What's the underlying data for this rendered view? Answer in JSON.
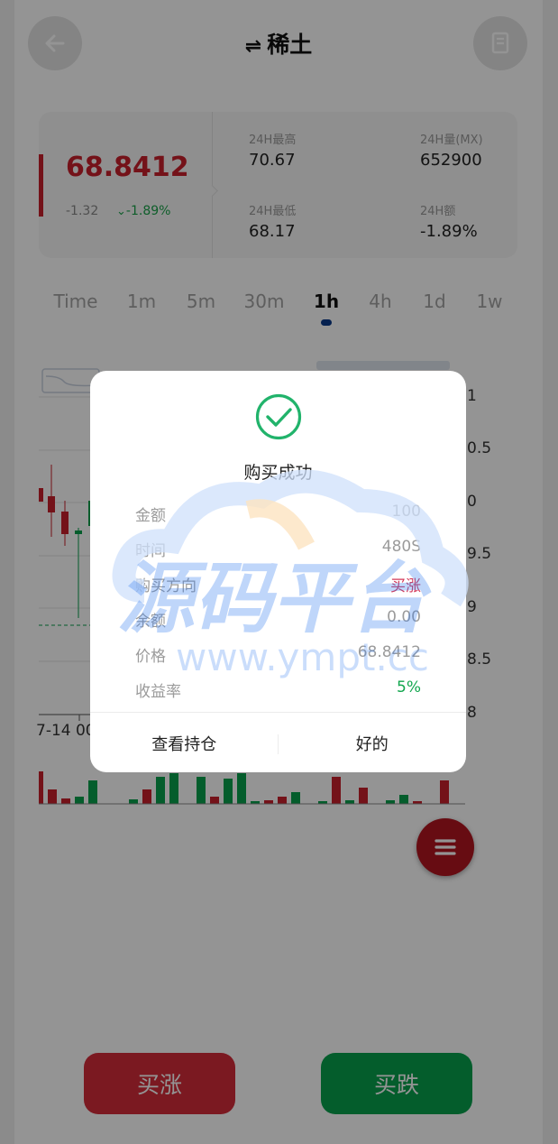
{
  "header": {
    "title": "稀土",
    "swap_symbol": "⇌",
    "back_icon": "arrow-left-icon",
    "book_icon": "document-icon"
  },
  "stats": {
    "price": "68.8412",
    "change": "-1.32",
    "change_pct": "-1.89%",
    "items": [
      {
        "label": "24H最高",
        "value": "70.67"
      },
      {
        "label": "24H量(MX)",
        "value": "652900"
      },
      {
        "label": "24H最低",
        "value": "68.17"
      },
      {
        "label": "24H额",
        "value": "-1.89%"
      }
    ]
  },
  "tabs": [
    "Time",
    "1m",
    "5m",
    "30m",
    "1h",
    "4h",
    "1d",
    "1w"
  ],
  "active_tab": "1h",
  "chart": {
    "y_labels": [
      "1",
      "0.5",
      "0",
      "9.5",
      "9",
      "8.5",
      "8"
    ],
    "x_labels": [
      "7-14 00"
    ]
  },
  "buttons": {
    "buy": "买涨",
    "sell": "买跌"
  },
  "modal": {
    "title": "购买成功",
    "rows": [
      {
        "label": "金额",
        "value": "100"
      },
      {
        "label": "时间",
        "value": "480S"
      },
      {
        "label": "购买方向",
        "value": "买涨"
      },
      {
        "label": "余额",
        "value": "0.00"
      },
      {
        "label": "价格",
        "value": "68.8412"
      },
      {
        "label": "收益率",
        "value": "5%"
      }
    ],
    "cancel_label": "查看持仓",
    "ok_label": "好的"
  },
  "watermark": {
    "text": "源码平台",
    "url": "www.ympt.cc"
  },
  "colors": {
    "up": "#d42c3a",
    "down": "#07a04d",
    "accent": "#0a3a8a"
  }
}
